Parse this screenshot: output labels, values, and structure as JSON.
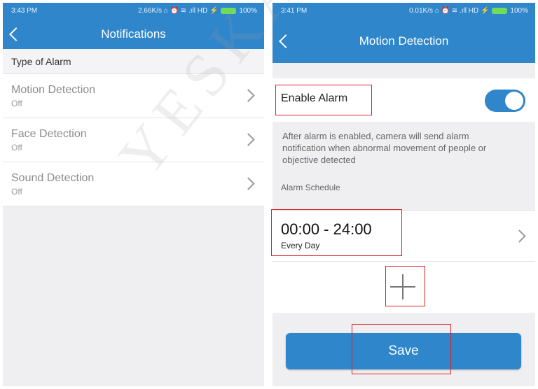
{
  "left_screen": {
    "status": {
      "time": "3:43 PM",
      "indicators": "2.66K/s ⌂ ⏰ ≋ .ıll HD ⚡",
      "battery": "100%"
    },
    "title": "Notifications",
    "section_header": "Type of Alarm",
    "items": [
      {
        "name": "Motion Detection",
        "state": "Off"
      },
      {
        "name": "Face Detection",
        "state": "Off"
      },
      {
        "name": "Sound Detection",
        "state": "Off"
      }
    ]
  },
  "right_screen": {
    "status": {
      "time": "3:41 PM",
      "indicators": "0.01K/s ⌂ ⏰ ≋ .ıll HD ⚡",
      "battery": "100%"
    },
    "title": "Motion Detection",
    "enable_label": "Enable Alarm",
    "enable_on": true,
    "description": "After alarm is enabled, camera will send alarm notification when abnormal movement of people or objective detected",
    "schedule_label": "Alarm Schedule",
    "schedule": {
      "range": "00:00 - 24:00",
      "repeat": "Every Day"
    },
    "save_label": "Save"
  },
  "watermark": "YESKAMO",
  "colors": {
    "primary": "#2f86cb",
    "highlight": "#d9232a",
    "toggle_on": "#2f86cb",
    "battery": "#6fdc5a"
  },
  "icons": [
    "back-icon",
    "chevron-right-icon",
    "plus-icon",
    "battery-icon"
  ]
}
